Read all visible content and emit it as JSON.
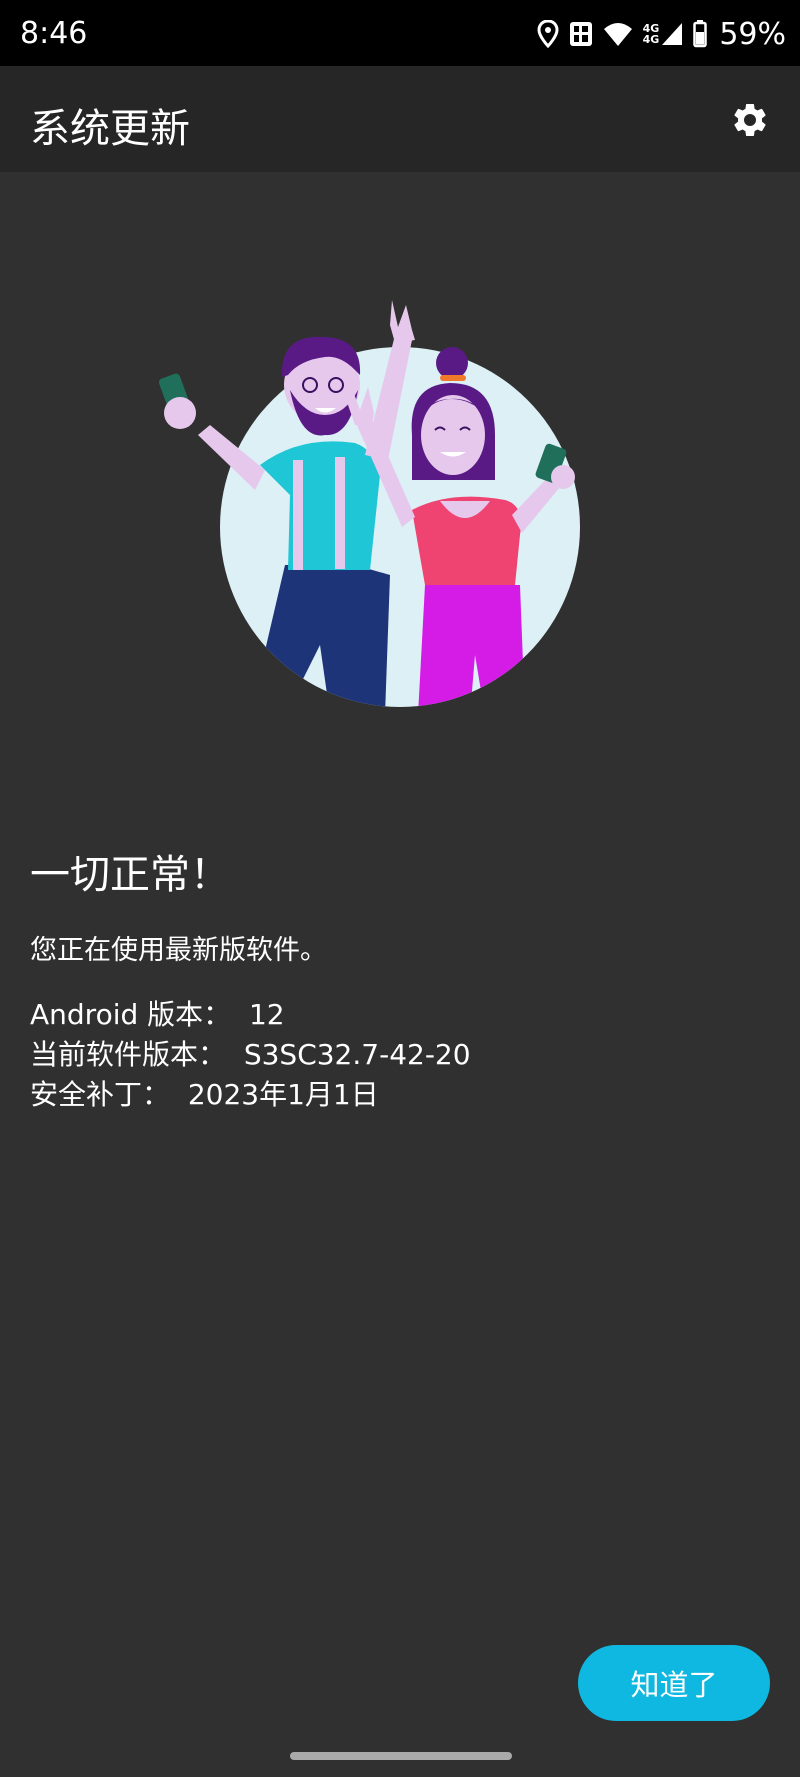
{
  "status_bar": {
    "time": "8:46",
    "icons": [
      "location-icon",
      "hd-icon",
      "wifi-icon",
      "signal-4g-icon",
      "battery-icon"
    ],
    "network_label_top": "4G",
    "network_label_bottom": "4G",
    "battery_percent": "59%"
  },
  "app_bar": {
    "title": "系统更新",
    "settings_icon": "gear-icon"
  },
  "content": {
    "heading": "一切正常！",
    "message": "您正在使用最新版软件。",
    "info": [
      {
        "label": "Android 版本：",
        "value": "12"
      },
      {
        "label": "当前软件版本：",
        "value": "S3SC32.7-42-20"
      },
      {
        "label": "安全补丁：",
        "value": "2023年1月1日"
      }
    ]
  },
  "actions": {
    "ok_label": "知道了"
  },
  "colors": {
    "background": "#303030",
    "app_bar": "#262626",
    "accent": "#0fb8e0"
  }
}
